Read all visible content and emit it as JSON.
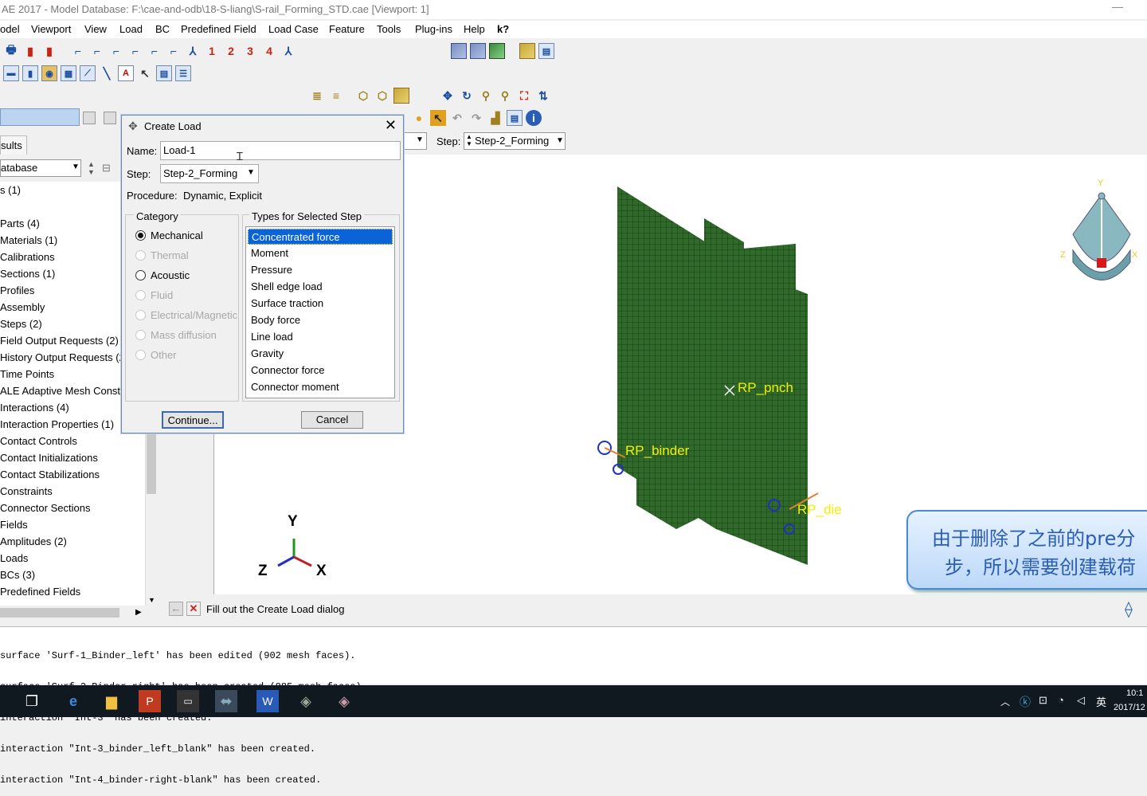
{
  "window": {
    "title": "AE 2017 - Model Database: F:\\cae-and-odb\\18-S-liang\\S-rail_Forming_STD.cae [Viewport: 1]",
    "min": "—"
  },
  "menu": [
    "odel",
    "Viewport",
    "View",
    "Load",
    "BC",
    "Predefined Field",
    "Load Case",
    "Feature",
    "Tools",
    "Plug-ins",
    "Help",
    "k?"
  ],
  "toolbar": {
    "step_nums": [
      "1",
      "2",
      "3",
      "4"
    ]
  },
  "tabs": {
    "results": "sults"
  },
  "db_combo": "atabase",
  "tree": {
    "first": "s (1)",
    "items": [
      "Parts (4)",
      "Materials (1)",
      "Calibrations",
      "Sections (1)",
      "Profiles",
      "Assembly",
      "Steps (2)",
      "Field Output Requests (2)",
      "History Output Requests (2",
      "Time Points",
      "ALE Adaptive Mesh Constr",
      "Interactions (4)",
      "Interaction Properties (1)",
      "Contact Controls",
      "Contact Initializations",
      "Contact Stabilizations",
      "Constraints",
      "Connector Sections",
      "Fields",
      "Amplitudes (2)",
      "Loads",
      "BCs (3)",
      "Predefined Fields"
    ]
  },
  "context": {
    "step_label": "Step:",
    "step_value": "Step-2_Forming"
  },
  "dialog": {
    "title": "Create Load",
    "close": "✕",
    "name_label": "Name:",
    "name_value": "Load-1",
    "step_label": "Step:",
    "step_value": "Step-2_Forming",
    "procedure_label": "Procedure:",
    "procedure_value": "Dynamic, Explicit",
    "category_title": "Category",
    "categories": [
      {
        "label": "Mechanical",
        "enabled": true,
        "selected": true
      },
      {
        "label": "Thermal",
        "enabled": false,
        "selected": false
      },
      {
        "label": "Acoustic",
        "enabled": true,
        "selected": false
      },
      {
        "label": "Fluid",
        "enabled": false,
        "selected": false
      },
      {
        "label": "Electrical/Magnetic",
        "enabled": false,
        "selected": false
      },
      {
        "label": "Mass diffusion",
        "enabled": false,
        "selected": false
      },
      {
        "label": "Other",
        "enabled": false,
        "selected": false
      }
    ],
    "types_title": "Types for Selected Step",
    "types": [
      "Concentrated force",
      "Moment",
      "Pressure",
      "Shell edge load",
      "Surface traction",
      "Body force",
      "Line load",
      "Gravity",
      "Connector force",
      "Connector moment"
    ],
    "selected_type": "Concentrated force",
    "continue": "Continue...",
    "cancel": "Cancel"
  },
  "viewport": {
    "labels": [
      "RP_pnch",
      "RP_binder",
      "RP_die"
    ],
    "triad": {
      "y": "Y",
      "z": "Z",
      "x": "X"
    },
    "view_cube": {
      "y": "Y",
      "z": "Z",
      "x": "X"
    }
  },
  "prompt": "Fill out the Create Load dialog",
  "messages": [
    "surface 'Surf-1_Binder_left' has been edited (902 mesh faces).",
    "surface 'Surf-2_Binder_right' has been created (885 mesh faces).",
    "interaction \"Int-3\" has been created.",
    "interaction \"Int-3_binder_left_blank\" has been created.",
    "interaction \"Int-4_binder-right-blank\" has been created."
  ],
  "subtitle": [
    "由于删除了之前的pre分",
    "步，所以需要创建载荷"
  ],
  "taskbar": {
    "time": "10:1",
    "date": "2017/12",
    "ime": "英"
  },
  "colors": {
    "mesh": "#2f6a2a",
    "mesh_line": "#1a3a15",
    "selection": "#0a64d8",
    "rp_label": "#f0f000"
  }
}
